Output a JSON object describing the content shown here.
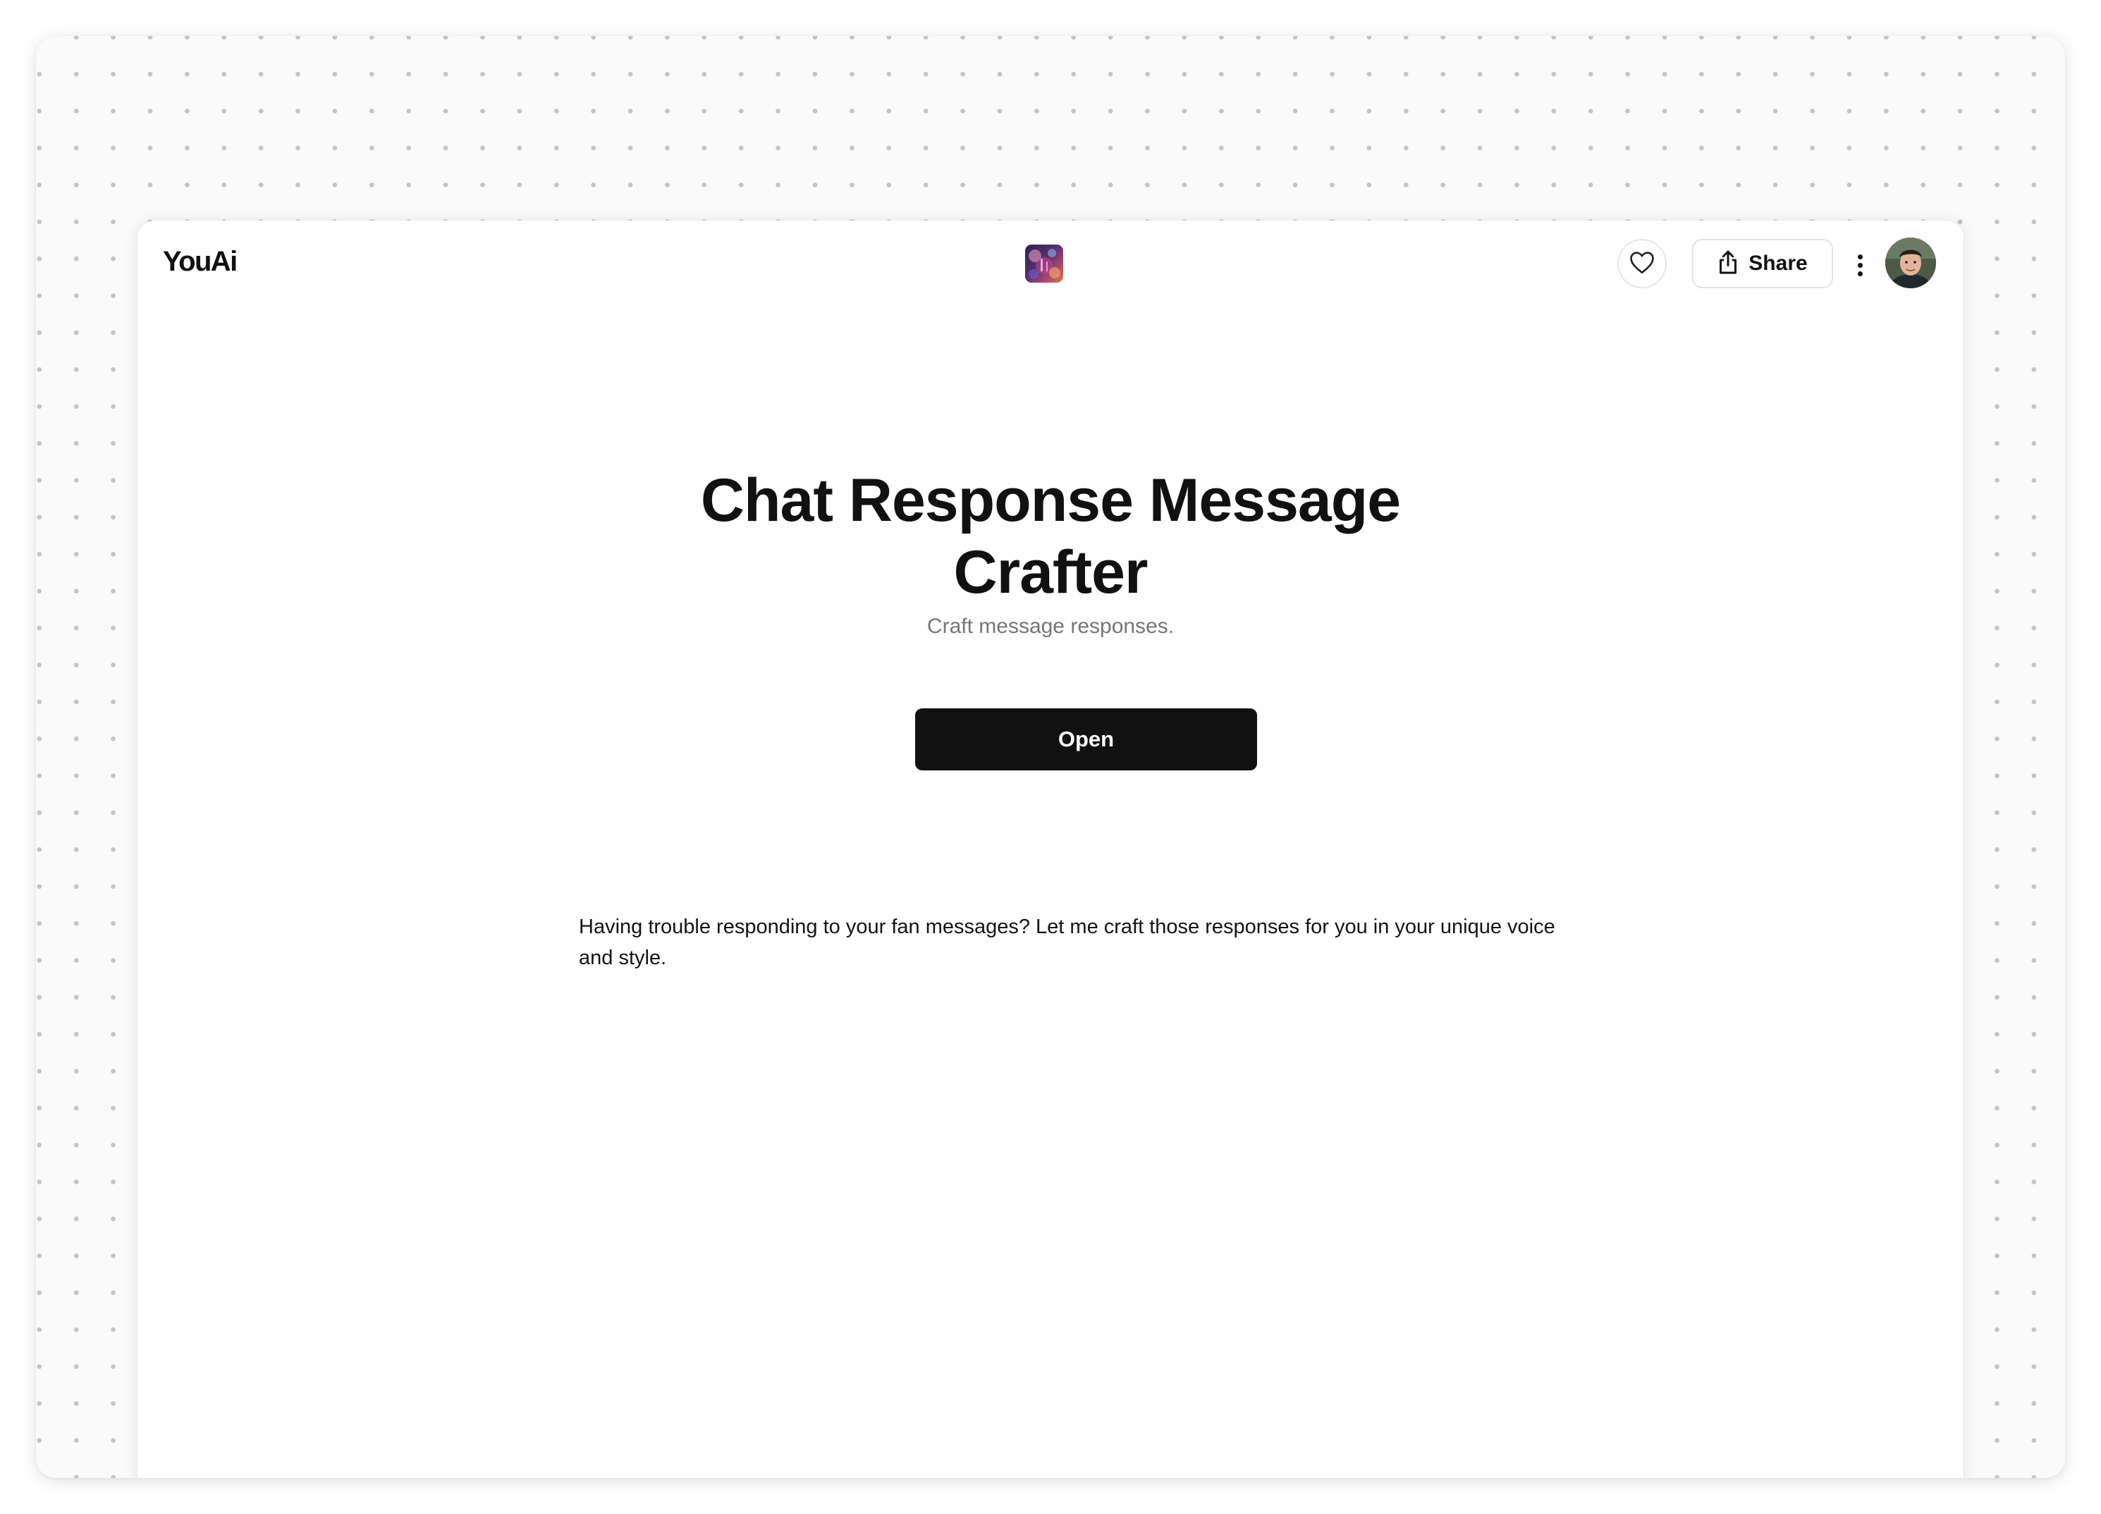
{
  "header": {
    "brand": "YouAi",
    "share_label": "Share",
    "icons": {
      "app": "app-thumbnail-icon",
      "favorite": "heart-icon",
      "share": "share-icon",
      "more": "more-vertical-icon",
      "avatar": "user-avatar"
    }
  },
  "main": {
    "title_line1": "Chat Response Message",
    "title_line2": "Crafter",
    "subtitle": "Craft message responses.",
    "open_label": "Open",
    "description": "Having trouble responding to your fan messages? Let me craft those responses for you in your unique voice and style."
  },
  "colors": {
    "primary_button": "#111111",
    "subtitle_text": "#767676",
    "dot_grid": "#c4c4c4"
  }
}
